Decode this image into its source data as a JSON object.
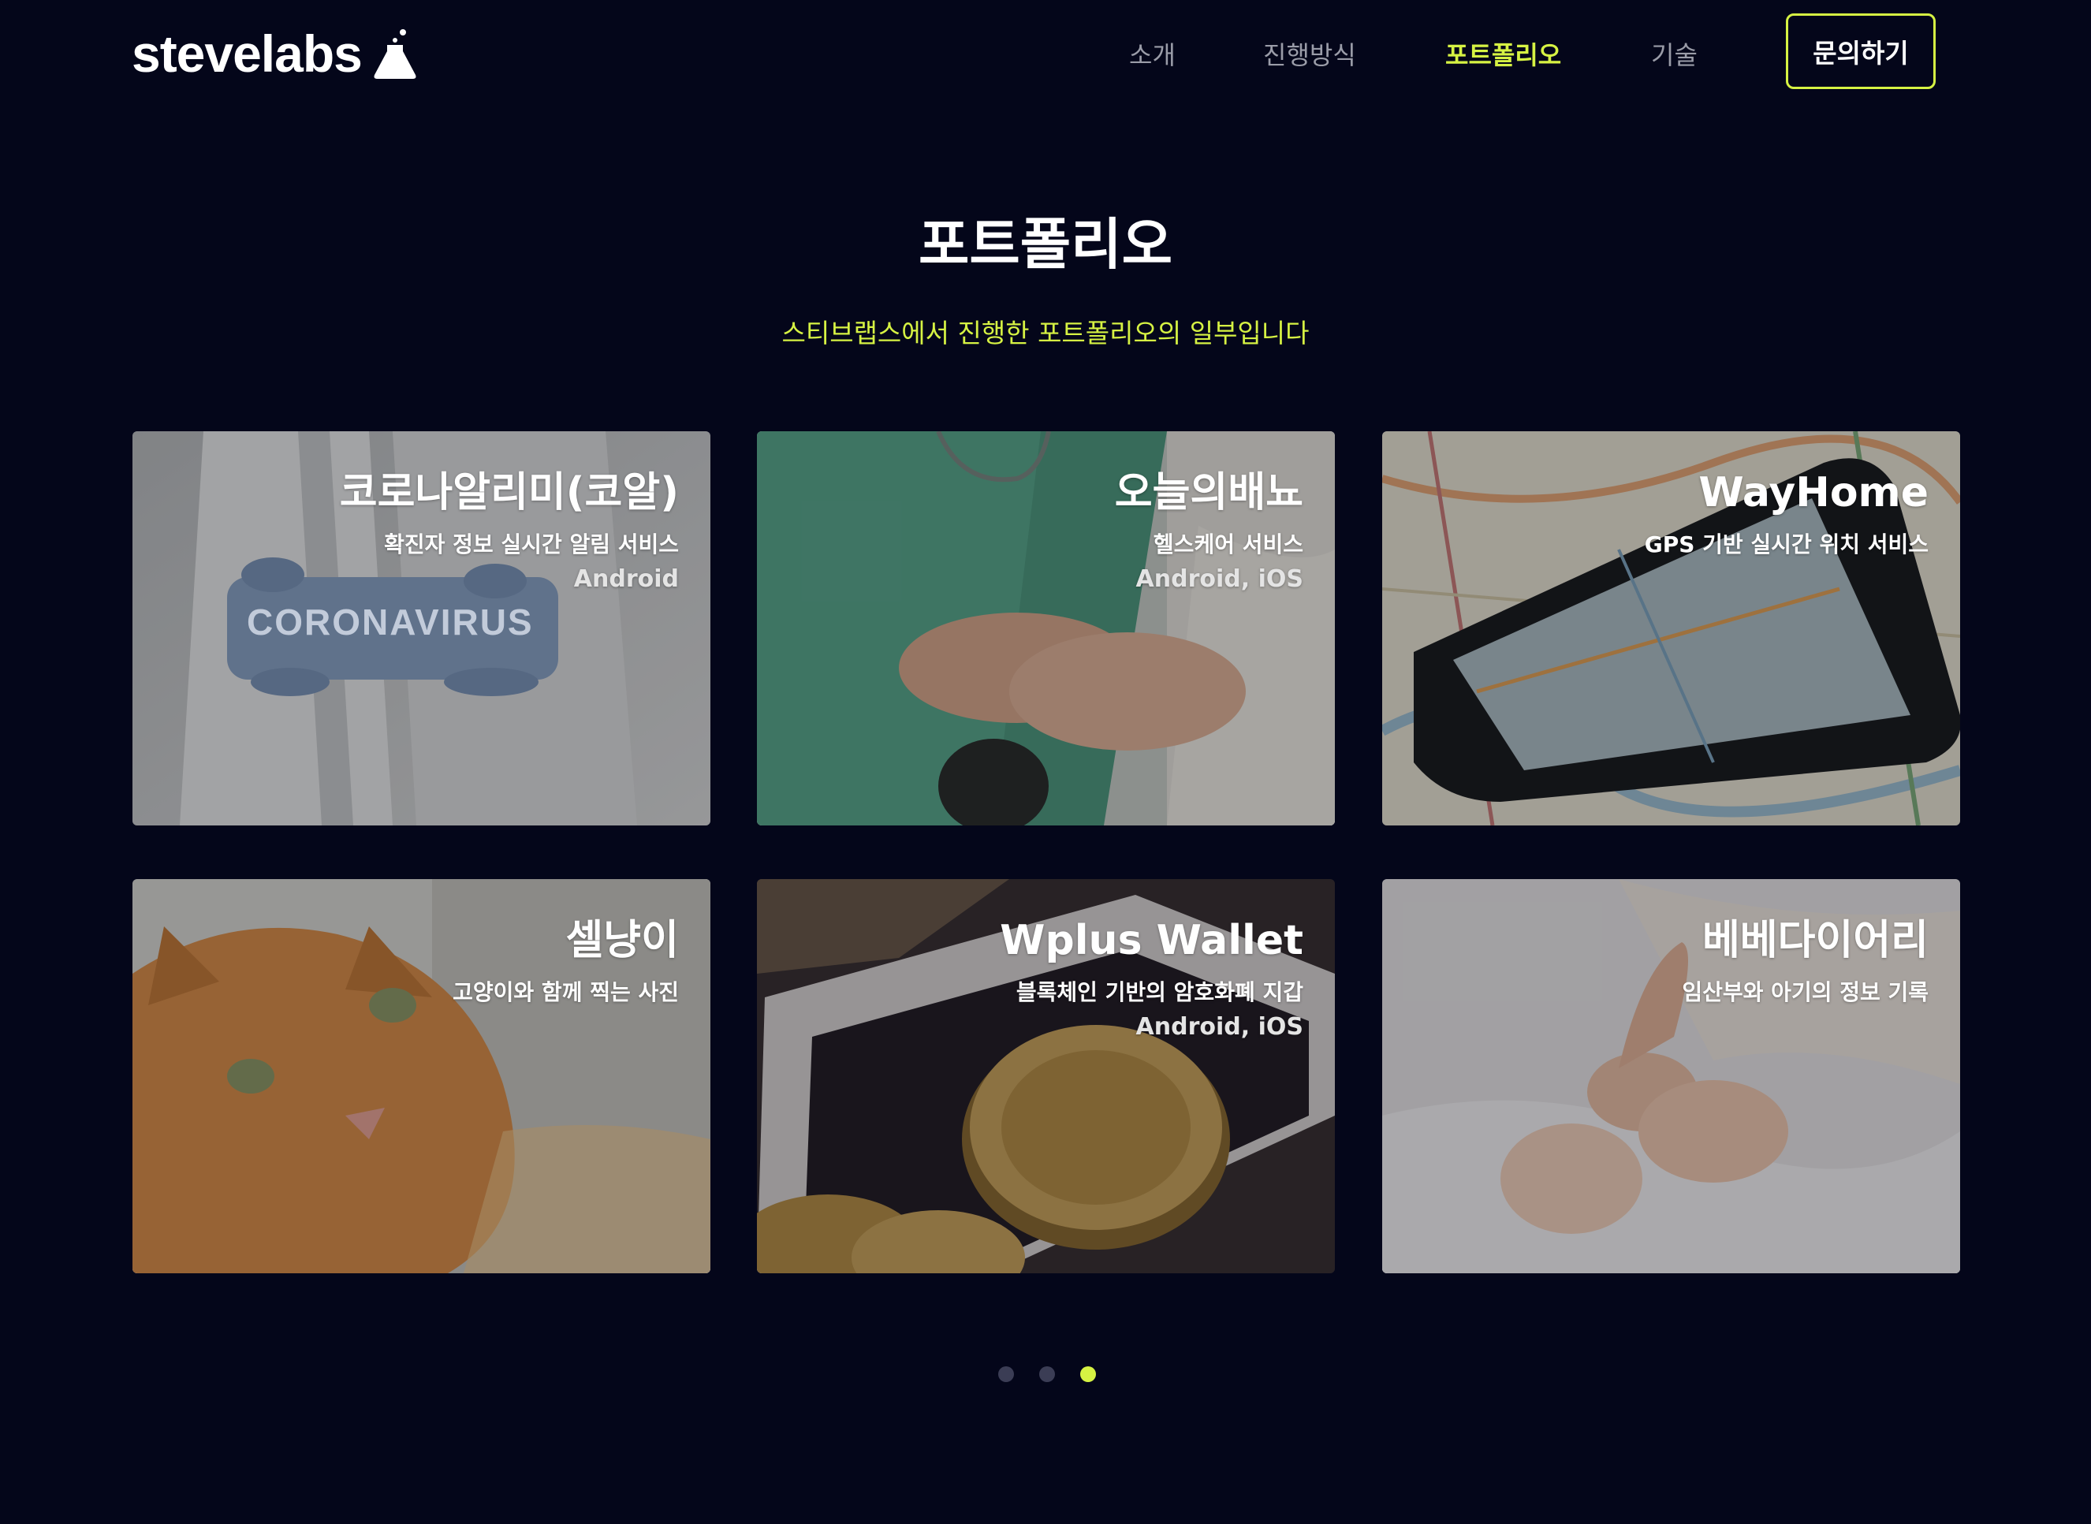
{
  "header": {
    "logo_text": "stevelabs",
    "logo_icon": "flask-icon",
    "nav": [
      {
        "label": "소개",
        "active": false
      },
      {
        "label": "진행방식",
        "active": false
      },
      {
        "label": "포트폴리오",
        "active": true
      },
      {
        "label": "기술",
        "active": false
      }
    ],
    "contact_label": "문의하기"
  },
  "section": {
    "title": "포트폴리오",
    "subtitle": "스티브랩스에서 진행한 포트폴리오의 일부입니다"
  },
  "portfolio": [
    {
      "title": "코로나알리미(코알)",
      "desc": "확진자 정보 실시간 알림 서비스",
      "platform": "Android",
      "image_text": "CORONAVIRUS"
    },
    {
      "title": "오늘의배뇨",
      "desc": "헬스케어 서비스",
      "platform": "Android, iOS"
    },
    {
      "title": "WayHome",
      "desc": "GPS 기반 실시간 위치 서비스",
      "platform": ""
    },
    {
      "title": "셀냥이",
      "desc": "고양이와 함께 찍는 사진",
      "platform": ""
    },
    {
      "title": "Wplus Wallet",
      "desc": "블록체인 기반의 암호화폐 지갑",
      "platform": "Android, iOS"
    },
    {
      "title": "베베다이어리",
      "desc": "임산부와 아기의 정보 기록",
      "platform": ""
    }
  ],
  "pagination": {
    "total": 3,
    "current": 3
  },
  "colors": {
    "background": "#04061a",
    "accent": "#d6f243",
    "nav_inactive": "#9a9ca8",
    "dot_inactive": "#3b3d55"
  }
}
